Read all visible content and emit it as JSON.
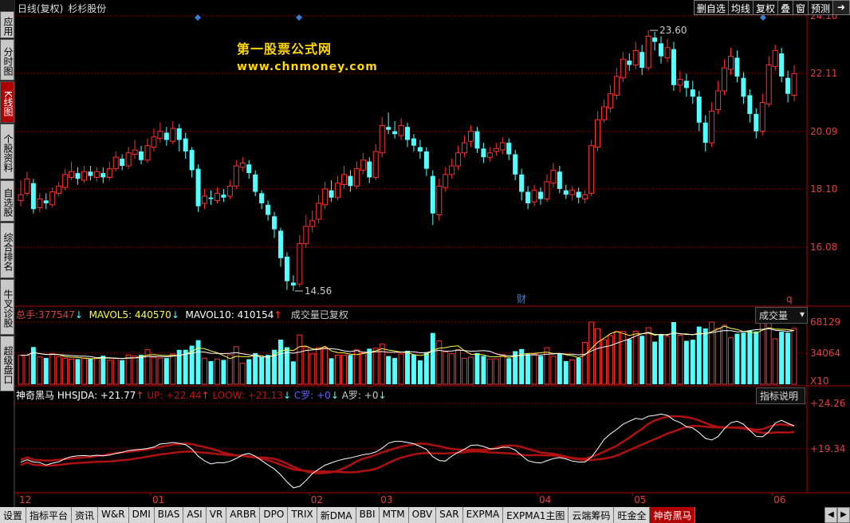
{
  "header": {
    "chart_mode": "日线(复权)",
    "stock_name": "杉杉股份"
  },
  "toolbar": [
    "删自选",
    "均线",
    "复权",
    "叠",
    "窗",
    "预测"
  ],
  "sidebar": [
    {
      "label": "应用",
      "active": false
    },
    {
      "label": "分时图",
      "active": false
    },
    {
      "label": "K线图",
      "active": true
    },
    {
      "label": "个股资料",
      "active": false
    },
    {
      "label": "自选股",
      "active": false
    },
    {
      "label": "综合排名",
      "active": false
    },
    {
      "label": "牛叉诊股",
      "active": false
    },
    {
      "label": "超级盘口",
      "active": false
    }
  ],
  "watermark": {
    "title": "第一股票公式网",
    "url": "www.chnmoney.com"
  },
  "price_axis": [
    "24.10",
    "22.11",
    "20.09",
    "18.10",
    "16.08"
  ],
  "annotations": {
    "high": "23.60",
    "low": "14.56",
    "finance_marker": "财",
    "q_marker": "q"
  },
  "volume_panel": {
    "label_total": "总手:",
    "total": "377547",
    "mavol5_label": "MAVOL5:",
    "mavol5": "440570",
    "mavol10_label": "MAVOL10:",
    "mavol10": "410154",
    "note": "成交量已复权",
    "dropdown": "成交量",
    "axis": [
      "68129",
      "34064"
    ],
    "unit": "X10"
  },
  "indicator_panel": {
    "name": "神奇黑马",
    "hhsjda": "HHSJDA: +21.77",
    "up": "UP: +22.44",
    "loow": "LOOW: +21.13",
    "c": "C罗: +0",
    "a": "A罗: +0",
    "help": "指标说明",
    "axis": [
      "+24.26",
      "+19.34"
    ]
  },
  "x_axis": [
    "12",
    "01",
    "02",
    "03",
    "04",
    "05",
    "06"
  ],
  "bottom_tabs": [
    "设置",
    "指标平台",
    "资讯",
    "W&R",
    "DMI",
    "BIAS",
    "ASI",
    "VR",
    "ARBR",
    "DPO",
    "TRIX",
    "新DMA",
    "BBI",
    "MTM",
    "OBV",
    "SAR",
    "EXPMA",
    "EXPMA1主图",
    "云端筹码",
    "旺金全",
    "神奇黑马"
  ],
  "active_bottom_tab": "神奇黑马",
  "colors": {
    "up": "#ff3030",
    "down": "#54ffff",
    "grid": "#b00000",
    "ma": "#ffffff"
  },
  "chart_data": {
    "type": "candlestick",
    "candles": [
      [
        17.7,
        17.9,
        18.4,
        17.5
      ],
      [
        17.95,
        18.45,
        18.7,
        17.85
      ],
      [
        18.3,
        17.4,
        18.45,
        17.25
      ],
      [
        17.45,
        17.75,
        17.95,
        17.3
      ],
      [
        17.7,
        17.6,
        17.95,
        17.4
      ],
      [
        17.55,
        18.0,
        18.15,
        17.45
      ],
      [
        17.95,
        18.2,
        18.35,
        17.85
      ],
      [
        18.15,
        18.6,
        18.8,
        18.05
      ],
      [
        18.5,
        18.7,
        19.05,
        18.4
      ],
      [
        18.65,
        18.45,
        18.85,
        18.25
      ],
      [
        18.4,
        18.7,
        18.9,
        18.3
      ],
      [
        18.7,
        18.55,
        18.9,
        18.4
      ],
      [
        18.5,
        18.7,
        18.85,
        18.35
      ],
      [
        18.65,
        18.5,
        18.85,
        18.3
      ],
      [
        18.5,
        18.8,
        19.05,
        18.4
      ],
      [
        18.8,
        19.2,
        19.4,
        18.7
      ],
      [
        19.15,
        18.9,
        19.3,
        18.75
      ],
      [
        18.9,
        19.35,
        19.55,
        18.8
      ],
      [
        19.3,
        19.45,
        19.8,
        19.15
      ],
      [
        19.4,
        19.1,
        19.6,
        18.95
      ],
      [
        19.1,
        19.6,
        19.85,
        19.0
      ],
      [
        19.55,
        19.9,
        20.2,
        19.4
      ],
      [
        19.85,
        20.1,
        20.4,
        19.7
      ],
      [
        20.05,
        19.8,
        20.25,
        19.6
      ],
      [
        19.75,
        20.2,
        20.45,
        19.65
      ],
      [
        20.2,
        19.8,
        20.35,
        19.4
      ],
      [
        19.85,
        19.4,
        20.05,
        19.15
      ],
      [
        19.45,
        18.75,
        19.55,
        18.5
      ],
      [
        18.8,
        17.5,
        18.95,
        17.3
      ],
      [
        17.6,
        17.85,
        18.1,
        17.4
      ],
      [
        17.8,
        17.75,
        18.05,
        17.55
      ],
      [
        17.7,
        17.95,
        18.15,
        17.6
      ],
      [
        17.9,
        17.8,
        18.1,
        17.65
      ],
      [
        17.85,
        18.2,
        18.4,
        17.75
      ],
      [
        18.2,
        18.9,
        19.1,
        18.1
      ],
      [
        18.85,
        19.0,
        19.2,
        18.7
      ],
      [
        18.95,
        18.65,
        19.1,
        18.45
      ],
      [
        18.6,
        18.0,
        18.75,
        17.85
      ],
      [
        17.95,
        17.6,
        18.05,
        17.4
      ],
      [
        17.55,
        17.2,
        17.7,
        17.0
      ],
      [
        17.15,
        16.7,
        17.3,
        16.4
      ],
      [
        16.65,
        15.7,
        16.75,
        15.4
      ],
      [
        15.75,
        14.9,
        15.9,
        14.6
      ],
      [
        14.85,
        14.75,
        15.1,
        14.56
      ],
      [
        14.8,
        16.2,
        16.5,
        14.7
      ],
      [
        16.2,
        16.8,
        17.2,
        16.05
      ],
      [
        16.8,
        17.0,
        17.35,
        16.6
      ],
      [
        17.05,
        17.6,
        17.9,
        16.9
      ],
      [
        17.55,
        18.1,
        18.35,
        17.4
      ],
      [
        18.05,
        17.8,
        18.4,
        17.65
      ],
      [
        17.8,
        18.3,
        18.55,
        17.7
      ],
      [
        18.25,
        18.6,
        18.9,
        18.1
      ],
      [
        18.55,
        18.2,
        18.75,
        18.0
      ],
      [
        18.2,
        18.8,
        19.05,
        18.1
      ],
      [
        18.75,
        19.1,
        19.35,
        18.6
      ],
      [
        19.05,
        18.5,
        19.2,
        18.3
      ],
      [
        18.5,
        19.4,
        19.65,
        18.4
      ],
      [
        19.35,
        20.3,
        20.6,
        19.2
      ],
      [
        20.25,
        20.15,
        20.75,
        20.0
      ],
      [
        20.1,
        20.0,
        20.45,
        19.85
      ],
      [
        19.95,
        20.3,
        20.55,
        19.8
      ],
      [
        20.25,
        19.8,
        20.4,
        19.55
      ],
      [
        19.85,
        19.6,
        20.0,
        19.4
      ],
      [
        19.55,
        19.4,
        19.8,
        19.15
      ],
      [
        19.4,
        18.8,
        19.55,
        18.55
      ],
      [
        18.55,
        17.25,
        18.75,
        16.85
      ],
      [
        17.2,
        18.2,
        18.45,
        17.0
      ],
      [
        18.15,
        18.6,
        18.85,
        18.0
      ],
      [
        18.6,
        18.9,
        19.15,
        18.45
      ],
      [
        18.9,
        19.35,
        19.6,
        18.75
      ],
      [
        19.35,
        19.7,
        19.95,
        19.2
      ],
      [
        19.75,
        20.1,
        20.3,
        19.55
      ],
      [
        20.1,
        19.5,
        20.25,
        19.35
      ],
      [
        19.5,
        19.2,
        19.7,
        19.0
      ],
      [
        19.2,
        19.35,
        19.55,
        19.05
      ],
      [
        19.4,
        19.5,
        19.7,
        19.25
      ],
      [
        19.45,
        19.7,
        19.9,
        19.3
      ],
      [
        19.7,
        19.3,
        19.85,
        19.1
      ],
      [
        19.3,
        18.6,
        19.45,
        18.4
      ],
      [
        18.6,
        18.0,
        18.8,
        17.7
      ],
      [
        18.0,
        17.6,
        18.2,
        17.4
      ],
      [
        17.65,
        18.05,
        18.25,
        17.5
      ],
      [
        18.0,
        17.75,
        18.15,
        17.55
      ],
      [
        17.75,
        18.35,
        18.6,
        17.65
      ],
      [
        18.3,
        18.75,
        19.0,
        18.15
      ],
      [
        18.7,
        18.1,
        18.9,
        17.95
      ],
      [
        18.05,
        17.9,
        18.25,
        17.75
      ],
      [
        17.9,
        18.05,
        18.2,
        17.7
      ],
      [
        18.0,
        17.8,
        18.15,
        17.6
      ],
      [
        17.75,
        17.9,
        18.05,
        17.6
      ],
      [
        17.95,
        19.6,
        19.8,
        17.85
      ],
      [
        19.55,
        20.5,
        20.8,
        19.4
      ],
      [
        20.5,
        20.95,
        21.2,
        20.4
      ],
      [
        20.9,
        21.4,
        21.7,
        20.75
      ],
      [
        21.35,
        22.0,
        22.3,
        21.2
      ],
      [
        21.95,
        22.6,
        22.85,
        21.8
      ],
      [
        22.55,
        22.4,
        22.8,
        22.2
      ],
      [
        22.4,
        22.9,
        23.2,
        22.25
      ],
      [
        22.85,
        22.3,
        23.1,
        22.05
      ],
      [
        22.3,
        23.4,
        23.6,
        22.2
      ],
      [
        23.35,
        23.2,
        23.55,
        22.9
      ],
      [
        23.15,
        22.7,
        23.4,
        22.45
      ],
      [
        22.65,
        23.0,
        23.3,
        22.5
      ],
      [
        22.95,
        21.7,
        23.2,
        21.5
      ],
      [
        21.7,
        21.9,
        22.2,
        21.45
      ],
      [
        21.85,
        21.6,
        22.1,
        21.3
      ],
      [
        21.55,
        21.3,
        21.85,
        21.05
      ],
      [
        21.3,
        20.4,
        21.5,
        20.1
      ],
      [
        20.4,
        19.7,
        20.65,
        19.4
      ],
      [
        19.7,
        20.8,
        21.1,
        19.55
      ],
      [
        20.85,
        21.5,
        21.85,
        20.7
      ],
      [
        21.5,
        22.3,
        22.6,
        21.35
      ],
      [
        22.25,
        22.7,
        23.0,
        22.05
      ],
      [
        22.65,
        22.0,
        22.9,
        21.8
      ],
      [
        21.95,
        21.3,
        22.15,
        21.05
      ],
      [
        21.35,
        20.7,
        21.55,
        20.4
      ],
      [
        20.7,
        20.1,
        20.9,
        19.85
      ],
      [
        20.1,
        21.1,
        21.4,
        19.95
      ],
      [
        21.05,
        22.4,
        22.7,
        20.95
      ],
      [
        22.35,
        22.9,
        23.1,
        22.2
      ],
      [
        22.8,
        22.0,
        23.0,
        21.8
      ],
      [
        21.95,
        21.4,
        22.2,
        21.1
      ],
      [
        21.35,
        22.1,
        22.4,
        21.15
      ]
    ],
    "ma_lines": "MAVOL5, MAVOL10, HHSJDA, UP, LOOW"
  }
}
